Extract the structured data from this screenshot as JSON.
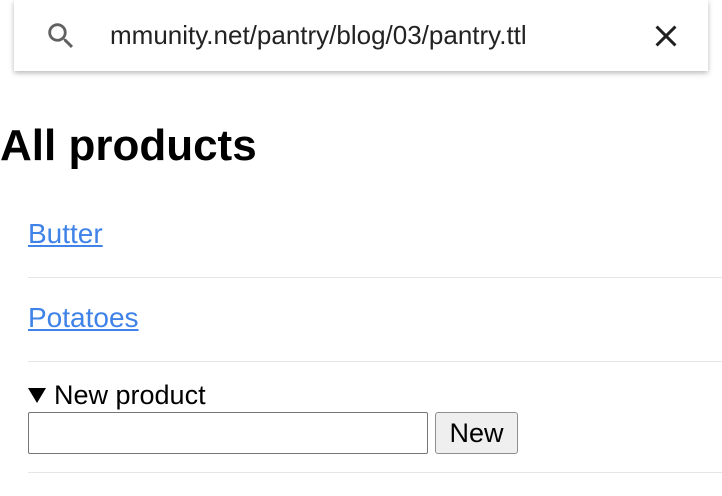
{
  "search": {
    "value": "mmunity.net/pantry/blog/03/pantry.ttl",
    "search_icon": "search-icon",
    "close_icon": "close-icon"
  },
  "page": {
    "title": "All products"
  },
  "products": [
    {
      "label": "Butter"
    },
    {
      "label": "Potatoes"
    }
  ],
  "new_product": {
    "summary": "New product",
    "input_value": "",
    "button_label": "New",
    "triangle_icon": "triangle-down-icon"
  },
  "colors": {
    "link": "#3f82e8",
    "divider": "#e6e6e6"
  }
}
